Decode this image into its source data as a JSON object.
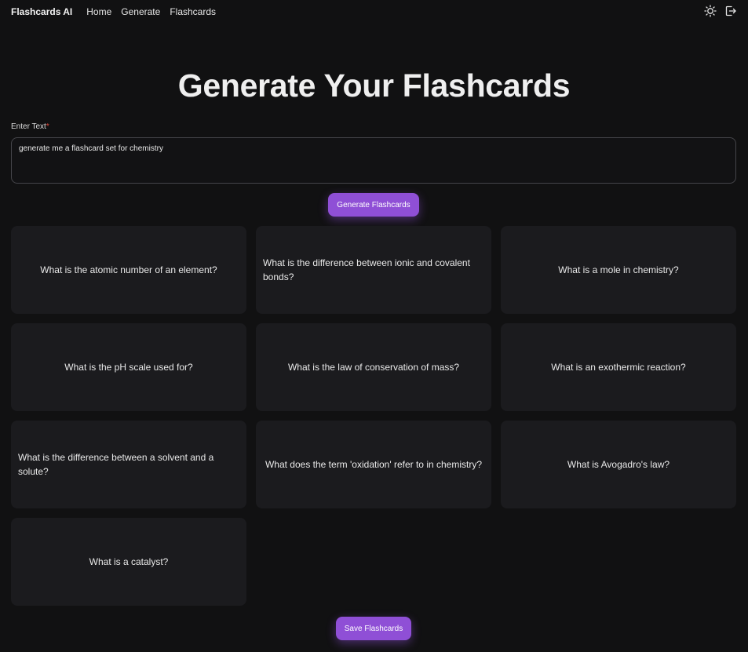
{
  "nav": {
    "brand": "Flashcards AI",
    "links": [
      "Home",
      "Generate",
      "Flashcards"
    ],
    "icons": [
      "sun-icon",
      "logout-icon"
    ]
  },
  "main": {
    "title": "Generate Your Flashcards",
    "input_label": "Enter Text",
    "input_required_mark": "*",
    "input_value": "generate me a flashcard set for chemistry",
    "generate_button": "Generate Flashcards",
    "save_button": "Save Flashcards"
  },
  "flashcards": [
    "What is the atomic number of an element?",
    "What is the difference between ionic and covalent bonds?",
    "What is a mole in chemistry?",
    "What is the pH scale used for?",
    "What is the law of conservation of mass?",
    "What is an exothermic reaction?",
    "What is the difference between a solvent and a solute?",
    "What does the term 'oxidation' refer to in chemistry?",
    "What is Avogadro's law?",
    "What is a catalyst?"
  ],
  "colors": {
    "background": "#111112",
    "card": "#1b1b1e",
    "accent": "#8f4fd6",
    "required": "#e0473b"
  }
}
